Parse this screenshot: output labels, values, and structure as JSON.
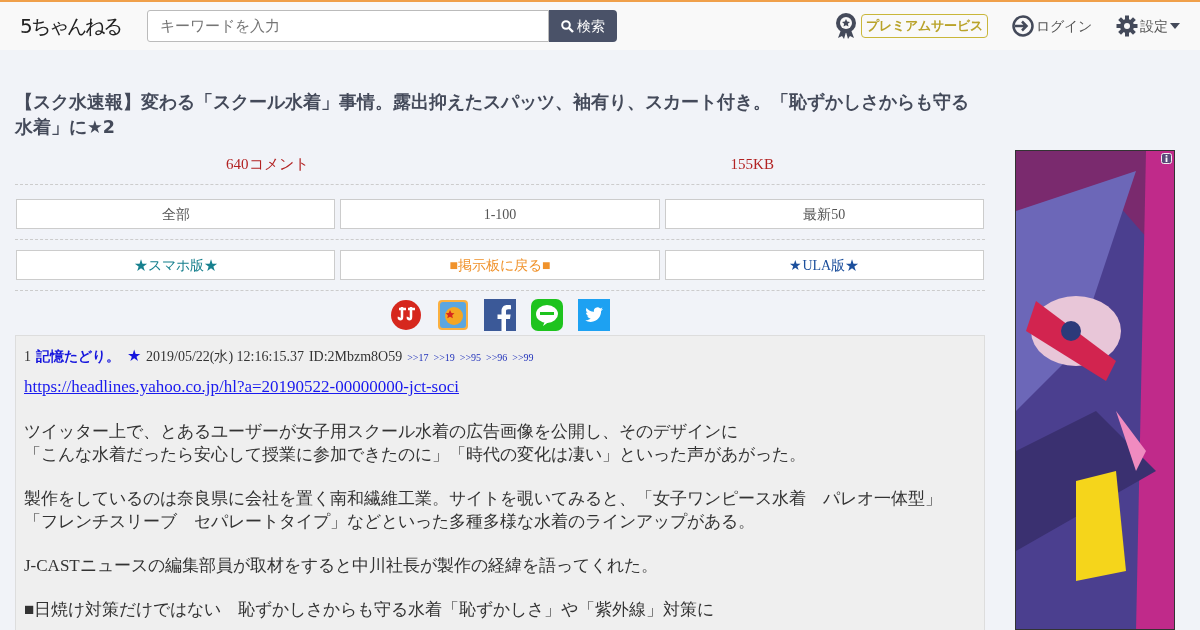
{
  "header": {
    "logo": "5ちゃんねる",
    "search": {
      "placeholder": "キーワードを入力",
      "button": "検索"
    },
    "premium": "プレミアムサービス",
    "login": "ログイン",
    "settings": "設定"
  },
  "thread": {
    "title": "【スク水速報】変わる「スクール水着」事情。露出抑えたスパッツ、袖有り、スカート付き。「恥ずかしさからも守る水着」に★2",
    "stats": [
      "640コメント",
      "155KB"
    ],
    "nav_rows": [
      [
        {
          "label": "全部",
          "color": "#555555"
        },
        {
          "label": "1-100",
          "color": "#555555"
        },
        {
          "label": "最新50",
          "color": "#555555"
        }
      ],
      [
        {
          "label": "★スマホ版★",
          "color": "#17808e"
        },
        {
          "label": "■掲示板に戻る■",
          "color": "#f0922b"
        },
        {
          "label": "★ULA版★",
          "color": "#1c4f9c"
        }
      ]
    ]
  },
  "post": {
    "number": "1",
    "name": "記憶たどり。",
    "mark": "★",
    "date": "2019/05/22(水) 12:16:15.37",
    "id": "ID:2Mbzm8O59",
    "replies": [
      ">>17",
      ">>19",
      ">>95",
      ">>96",
      ">>99"
    ],
    "link": "https://headlines.yahoo.co.jp/hl?a=20190522-00000000-jct-soci",
    "paragraphs": [
      [
        "ツイッター上で、とあるユーザーが女子用スクール水着の広告画像を公開し、そのデザインに",
        "「こんな水着だったら安心して授業に参加できたのに」「時代の変化は凄い」といった声があがった。"
      ],
      [
        "製作をしているのは奈良県に会社を置く南和繊維工業。サイトを覗いてみると、「女子ワンピース水着　パレオ一体型」",
        "「フレンチスリーブ　セパレートタイプ」などといった多種多様な水着のラインアップがある。"
      ],
      [
        "J-CASTニュースの編集部員が取材をすると中川社長が製作の経緯を語ってくれた。"
      ],
      [
        "■日焼け対策だけではない　恥ずかしさからも守る水着「恥ずかしさ」や「紫外線」対策に"
      ]
    ]
  }
}
